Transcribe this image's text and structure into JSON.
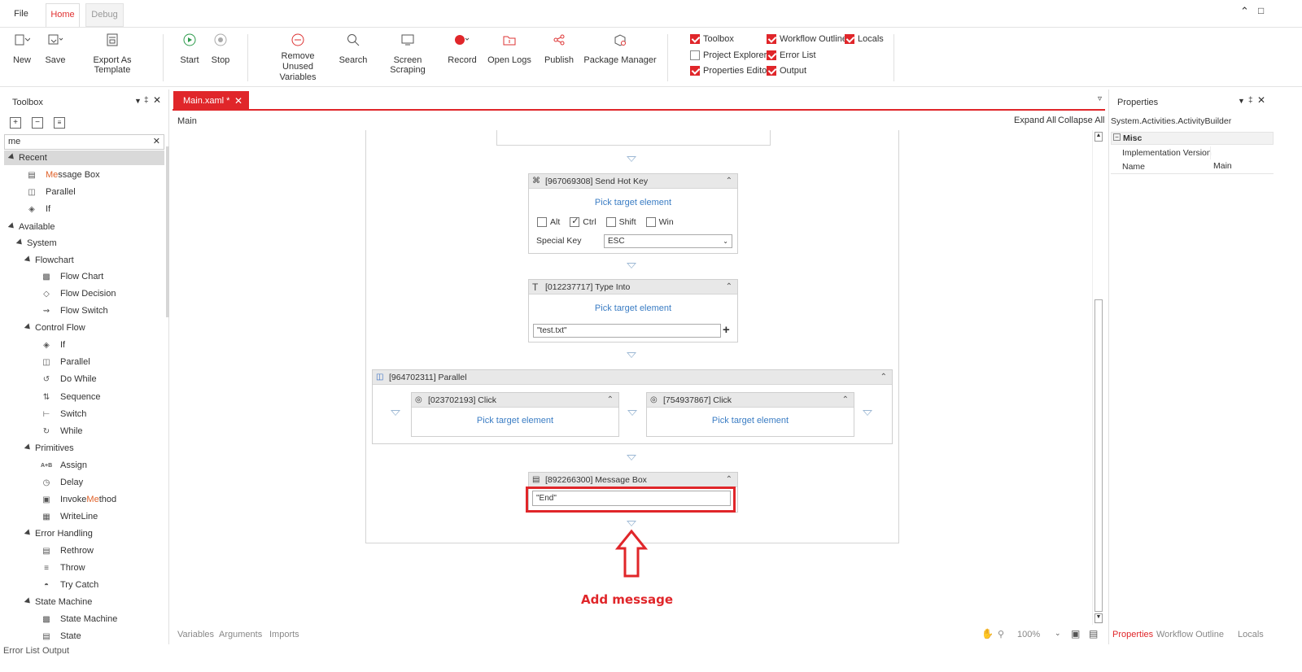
{
  "menu": {
    "file": "File",
    "home": "Home",
    "debug": "Debug"
  },
  "ribbon": {
    "new": "New",
    "save": "Save",
    "export": "Export As Template",
    "start": "Start",
    "stop": "Stop",
    "remove_unused_1": "Remove Unused",
    "remove_unused_2": "Variables",
    "search": "Search",
    "screen_scraping": "Screen Scraping",
    "record": "Record",
    "open_logs": "Open Logs",
    "publish": "Publish",
    "package_manager": "Package Manager",
    "toggles": [
      {
        "label": "Toolbox",
        "checked": true
      },
      {
        "label": "Workflow Outline",
        "checked": true
      },
      {
        "label": "Locals",
        "checked": true
      },
      {
        "label": "Project Explorer",
        "checked": false
      },
      {
        "label": "Error List",
        "checked": true
      },
      {
        "label": "Properties Editor",
        "checked": true
      },
      {
        "label": "Output",
        "checked": true
      }
    ]
  },
  "toolbox": {
    "title": "Toolbox",
    "search_value": "me",
    "recent": "Recent",
    "recent_items": {
      "mb_hl": "Me",
      "mb_rest": "ssage Box",
      "parallel": "Parallel",
      "if": "If"
    },
    "available": "Available",
    "system": "System",
    "flowchart": "Flowchart",
    "flowchart_items": [
      "Flow Chart",
      "Flow Decision",
      "Flow Switch"
    ],
    "control_flow": "Control Flow",
    "control_flow_items": [
      "If",
      "Parallel",
      "Do While",
      "Sequence",
      "Switch",
      "While"
    ],
    "primitives": "Primitives",
    "primitive_items": {
      "assign": "Assign",
      "delay": "Delay",
      "invoke_a": "Invoke",
      "invoke_hl": "Me",
      "invoke_b": "thod",
      "writeline": "WriteLine"
    },
    "error_handling": "Error Handling",
    "error_items": [
      "Rethrow",
      "Throw",
      "Try Catch"
    ],
    "state_machine": "State Machine",
    "state_items": [
      "State Machine",
      "State"
    ]
  },
  "designer": {
    "tab": "Main.xaml *",
    "breadcrumb": "Main",
    "expand_all": "Expand All",
    "collapse_all": "Collapse All",
    "hotkey": {
      "title": "[967069308] Send Hot Key",
      "pick": "Pick target element",
      "alt": "Alt",
      "ctrl": "Ctrl",
      "shift": "Shift",
      "win": "Win",
      "special_key_label": "Special Key",
      "special_key_value": "ESC"
    },
    "typeinto": {
      "title": "[012237717] Type Into",
      "pick": "Pick target element",
      "value": "\"test.txt\""
    },
    "parallel": {
      "title": "[964702311] Parallel"
    },
    "click1": {
      "title": "[023702193] Click",
      "pick": "Pick target element"
    },
    "click2": {
      "title": "[754937867] Click",
      "pick": "Pick target element"
    },
    "msgbox": {
      "title": "[892266300] Message Box",
      "value": "\"End\""
    },
    "annotation": "Add message",
    "bottom_tabs": {
      "variables": "Variables",
      "arguments": "Arguments",
      "imports": "Imports"
    },
    "zoom": "100%"
  },
  "properties": {
    "title": "Properties",
    "type": "System.Activities.ActivityBuilder",
    "category": "Misc",
    "rows": [
      {
        "name": "Implementation Version",
        "value": ""
      },
      {
        "name": "Name",
        "value": "Main"
      }
    ],
    "tabs": {
      "properties": "Properties",
      "outline": "Workflow Outline",
      "locals": "Locals"
    }
  },
  "status": {
    "error_list": "Error List",
    "output": "Output"
  },
  "colors": {
    "accent": "#e0262a",
    "link": "#3b7dc4"
  }
}
